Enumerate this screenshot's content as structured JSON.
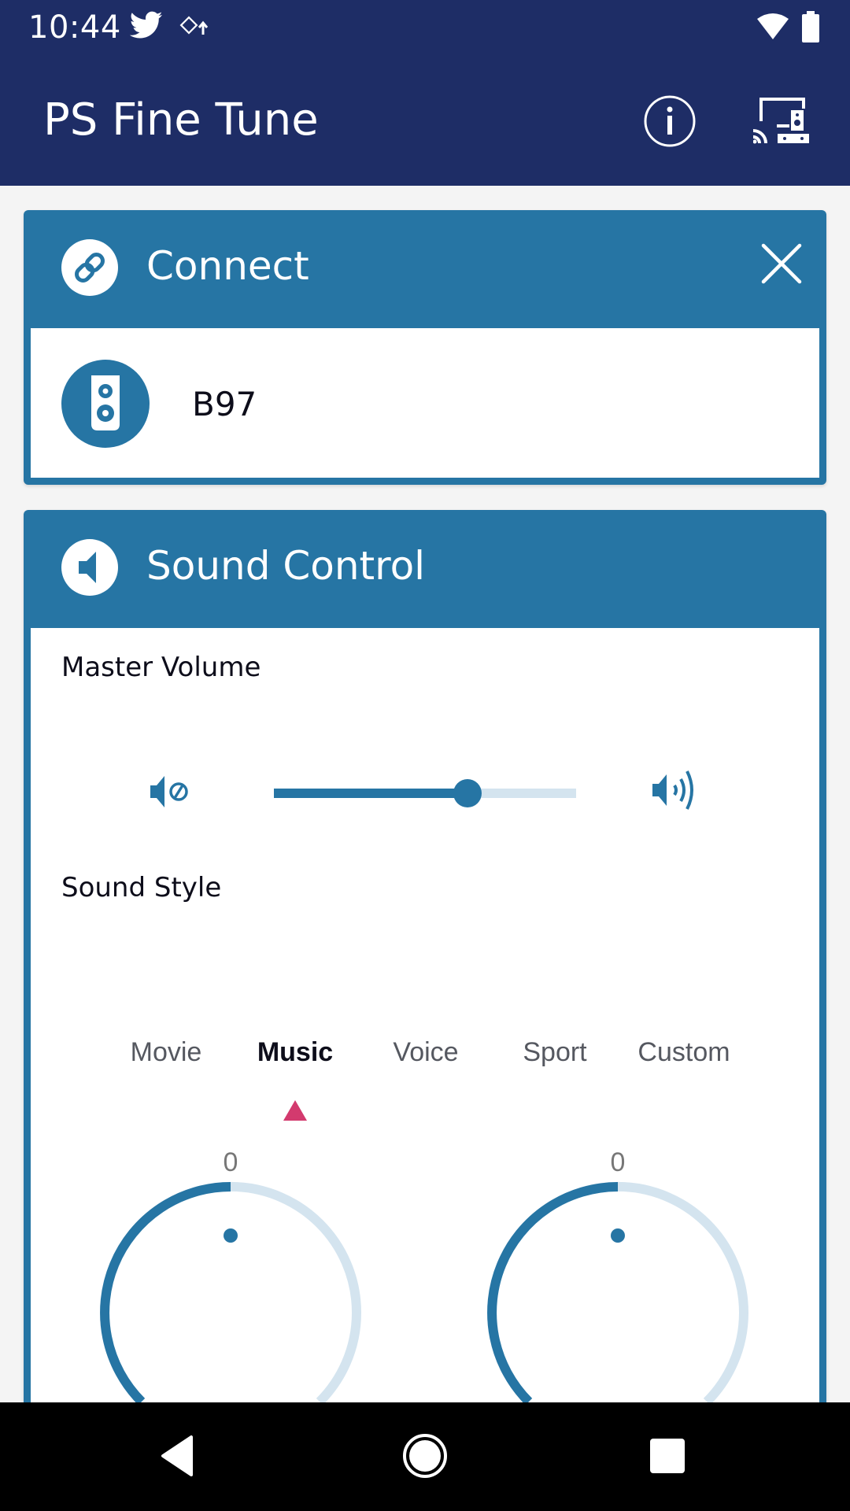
{
  "status_bar": {
    "time": "10:44",
    "icons": [
      "twitter-icon",
      "rotate-icon",
      "wifi-icon",
      "battery-icon"
    ]
  },
  "app_bar": {
    "title": "PS Fine Tune",
    "actions": [
      {
        "name": "info-icon",
        "label": "Info"
      },
      {
        "name": "cast-speaker-icon",
        "label": "Devices"
      }
    ]
  },
  "connect_card": {
    "title": "Connect",
    "header_icon": "link-icon",
    "close_icon": "close-icon",
    "device": {
      "icon": "speaker-icon",
      "name": "B97"
    }
  },
  "sound_control_card": {
    "title": "Sound Control",
    "header_icon": "speaker-icon",
    "master_volume": {
      "label": "Master Volume",
      "min_icon": "volume-mute-icon",
      "max_icon": "volume-up-icon",
      "value_fraction": 0.64
    },
    "sound_style": {
      "label": "Sound Style",
      "options": [
        "Movie",
        "Music",
        "Voice",
        "Sport",
        "Custom"
      ],
      "selected": "Music",
      "selected_index": 1
    },
    "knobs": [
      {
        "value": "0",
        "fraction": 0.5
      },
      {
        "value": "0",
        "fraction": 0.5
      }
    ]
  },
  "colors": {
    "app_bar": "#1e2d66",
    "accent": "#2675a4",
    "track_light": "#d4e4ef",
    "indicator": "#d33a6e",
    "background": "#f4f4f4"
  },
  "nav_bar": {
    "buttons": [
      "back-icon",
      "home-icon",
      "recents-icon"
    ]
  }
}
